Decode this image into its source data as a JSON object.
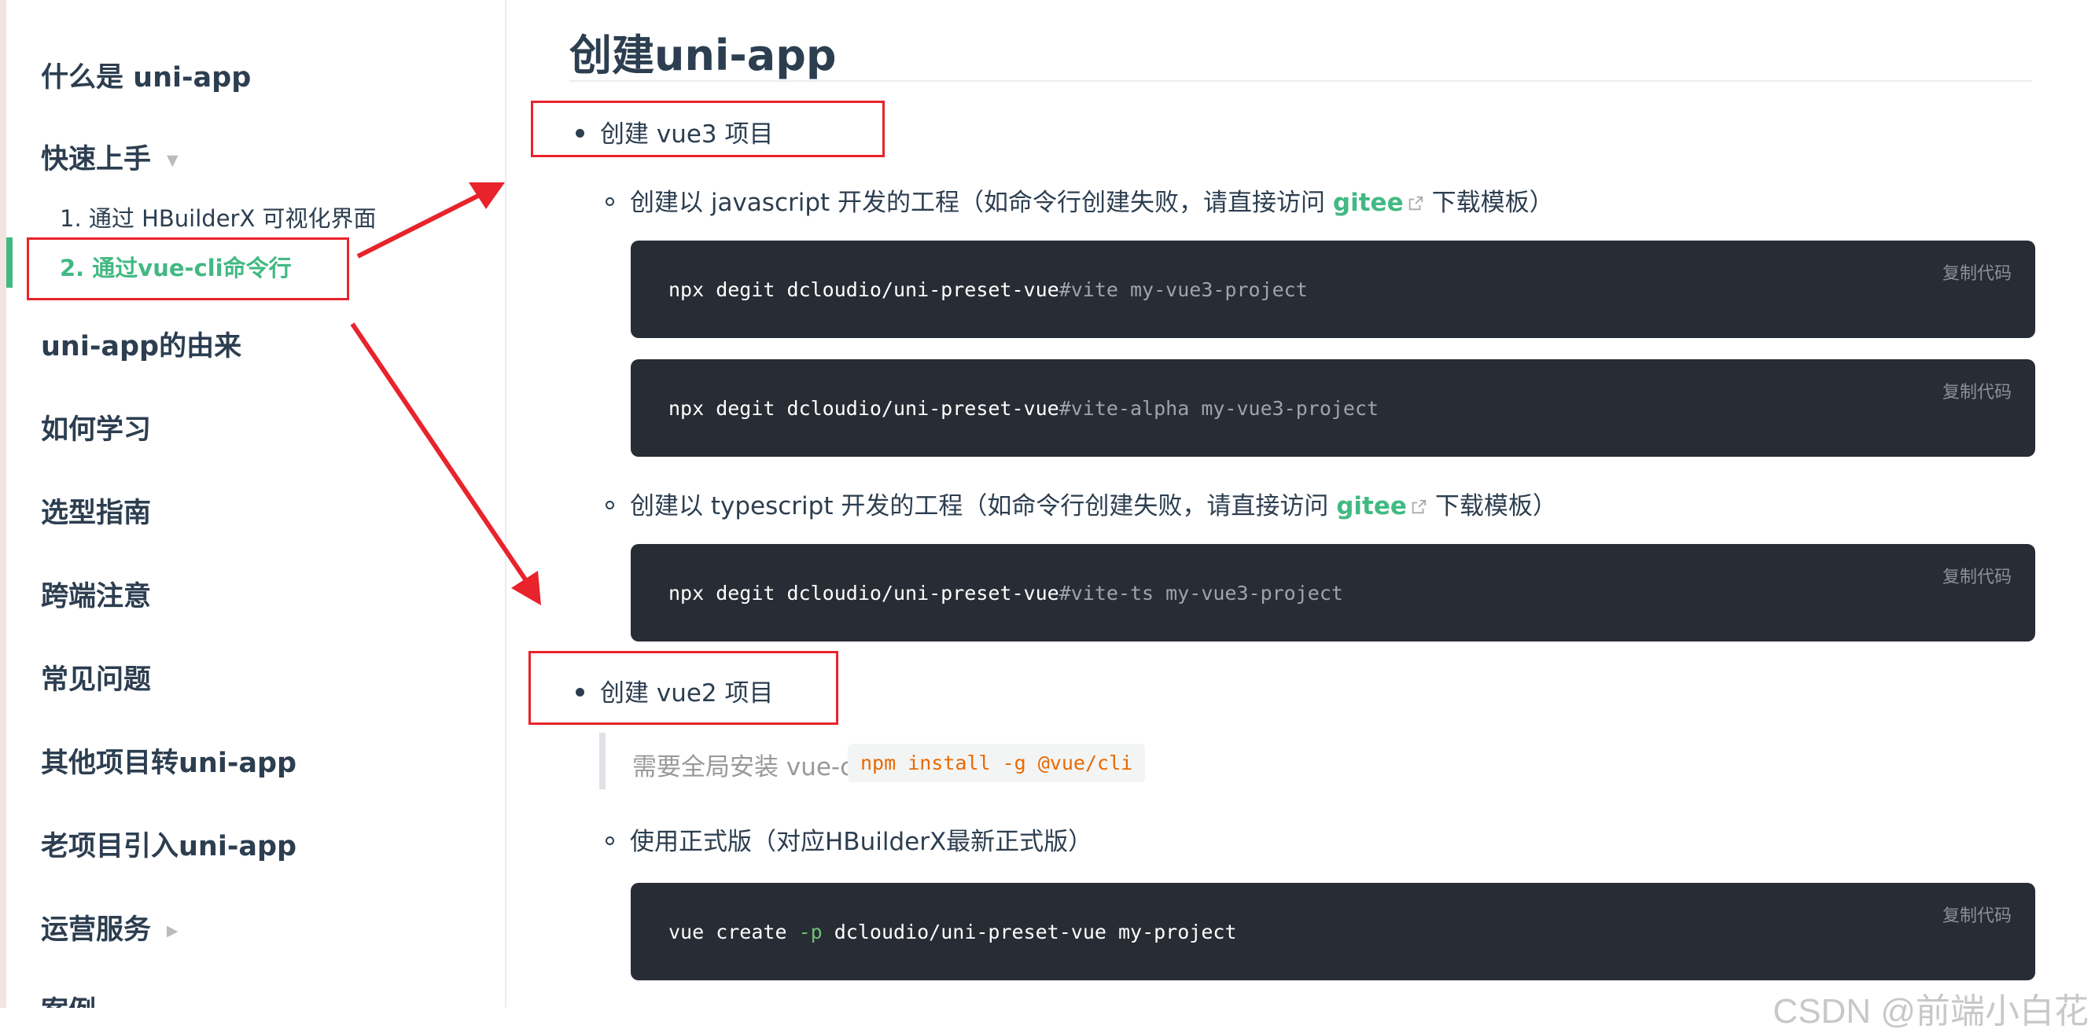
{
  "sidebar": {
    "sections": [
      {
        "label": "什么是 uni-app"
      },
      {
        "label": "快速上手"
      },
      {
        "label": "uni-app的由来"
      },
      {
        "label": "如何学习"
      },
      {
        "label": "选型指南"
      },
      {
        "label": "跨端注意"
      },
      {
        "label": "常见问题"
      },
      {
        "label": "其他项目转uni-app"
      },
      {
        "label": "老项目引入uni-app"
      },
      {
        "label": "运营服务"
      },
      {
        "label": "案例"
      }
    ],
    "subitems": [
      {
        "label": "1. 通过 HBuilderX 可视化界面"
      },
      {
        "label": "2. 通过vue-cli命令行"
      }
    ],
    "active_color": "#42b983"
  },
  "main": {
    "title": "创建uni-app",
    "vue3": {
      "heading": "创建 vue3 项目",
      "js": {
        "before": "创建以 javascript 开发的工程（如命令行创建失败，请直接访问",
        "link": "gitee",
        "after": "下载模板）"
      },
      "ts": {
        "before": "创建以 typescript 开发的工程（如命令行创建失败，请直接访问",
        "link": "gitee",
        "after": "下载模板）"
      },
      "code": [
        {
          "cmd": "npx degit dcloudio/uni-preset-vue",
          "hash": "#vite my-vue3-project"
        },
        {
          "cmd": "npx degit dcloudio/uni-preset-vue",
          "hash": "#vite-alpha my-vue3-project"
        },
        {
          "cmd": "npx degit dcloudio/uni-preset-vue",
          "hash": "#vite-ts my-vue3-project"
        }
      ]
    },
    "vue2": {
      "heading": "创建 vue2 项目",
      "note": "需要全局安装 vue-cli",
      "inline_code": "npm install -g @vue/cli",
      "stable": "使用正式版（对应HBuilderX最新正式版）",
      "code": {
        "a": "vue create",
        "flag": "-p",
        "b": "dcloudio/uni-preset-vue my-project"
      }
    },
    "copy_label": "复制代码"
  },
  "watermark": "CSDN @前端小白花",
  "colors": {
    "accent": "#42b983",
    "code_bg": "#282c34",
    "annotation": "#e8232b",
    "inline_code": "#e96900"
  },
  "icons": {
    "caret_down": "caret-down-icon",
    "caret_right": "caret-right-icon",
    "external": "external-link-icon"
  }
}
